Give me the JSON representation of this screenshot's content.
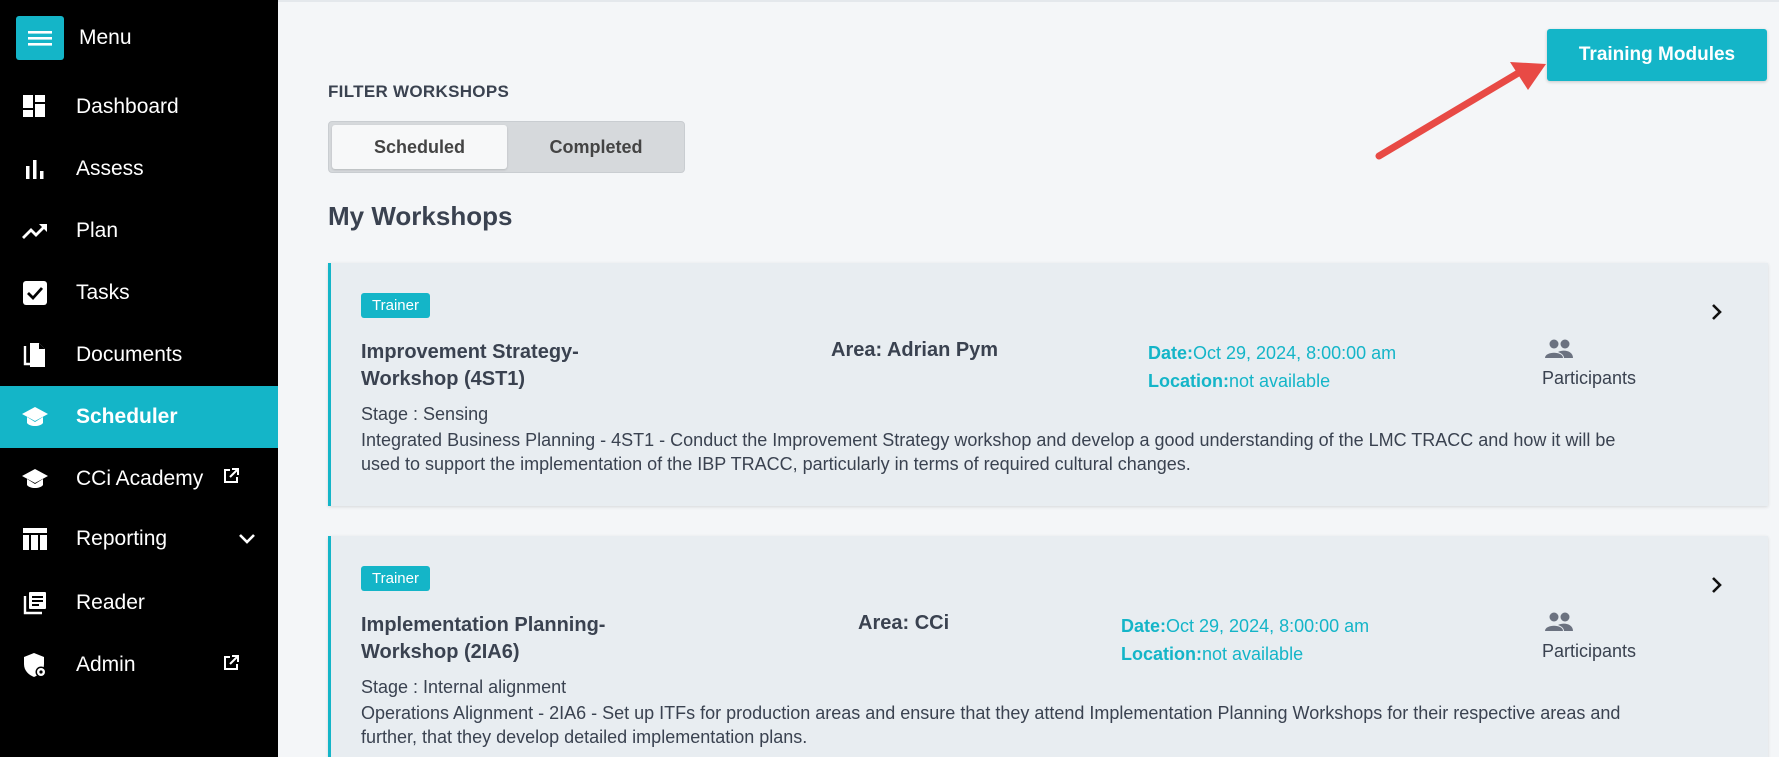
{
  "sidebar": {
    "menu_label": "Menu",
    "items": [
      {
        "label": "Dashboard",
        "icon": "dashboard-icon"
      },
      {
        "label": "Assess",
        "icon": "bar-chart-icon"
      },
      {
        "label": "Plan",
        "icon": "trending-up-icon"
      },
      {
        "label": "Tasks",
        "icon": "checkbox-icon"
      },
      {
        "label": "Documents",
        "icon": "documents-icon"
      },
      {
        "label": "Scheduler",
        "icon": "graduation-cap-icon",
        "active": true
      },
      {
        "label": "CCi Academy",
        "icon": "graduation-cap-icon",
        "external": true
      },
      {
        "label": "Reporting",
        "icon": "table-icon",
        "expandable": true
      },
      {
        "label": "Reader",
        "icon": "reader-icon"
      },
      {
        "label": "Admin",
        "icon": "shield-icon",
        "external": true
      }
    ]
  },
  "header": {
    "training_modules_label": "Training Modules"
  },
  "filter": {
    "title": "FILTER WORKSHOPS",
    "options": [
      "Scheduled",
      "Completed"
    ],
    "selected": "Scheduled"
  },
  "section_title": "My Workshops",
  "workshops": [
    {
      "badge": "Trainer",
      "title": "Improvement Strategy-Workshop (4ST1)",
      "area": "Area: Adrian Pym",
      "date_label": "Date:",
      "date_value": "Oct 29, 2024, 8:00:00 am",
      "location_label": "Location:",
      "location_value": "not available",
      "participants_label": "Participants",
      "stage": "Stage : Sensing",
      "description": "Integrated Business Planning - 4ST1 - Conduct the Improvement Strategy workshop and develop a good understanding of the LMC TRACC and how it will be used to support the implementation of the IBP TRACC, particularly in terms of required cultural changes."
    },
    {
      "badge": "Trainer",
      "title": "Implementation Planning-Workshop (2IA6)",
      "area": "Area: CCi",
      "date_label": "Date:",
      "date_value": "Oct 29, 2024, 8:00:00 am",
      "location_label": "Location:",
      "location_value": "not available",
      "participants_label": "Participants",
      "stage": "Stage : Internal alignment",
      "description": "Operations Alignment - 2IA6 - Set up ITFs for production areas and ensure that they attend Implementation Planning Workshops for their respective areas and further, that they develop detailed implementation plans."
    }
  ],
  "colors": {
    "accent": "#14b5c8",
    "sidebar_bg": "#000000",
    "card_bg": "#e8edf1",
    "annotation_arrow": "#e84a45"
  }
}
